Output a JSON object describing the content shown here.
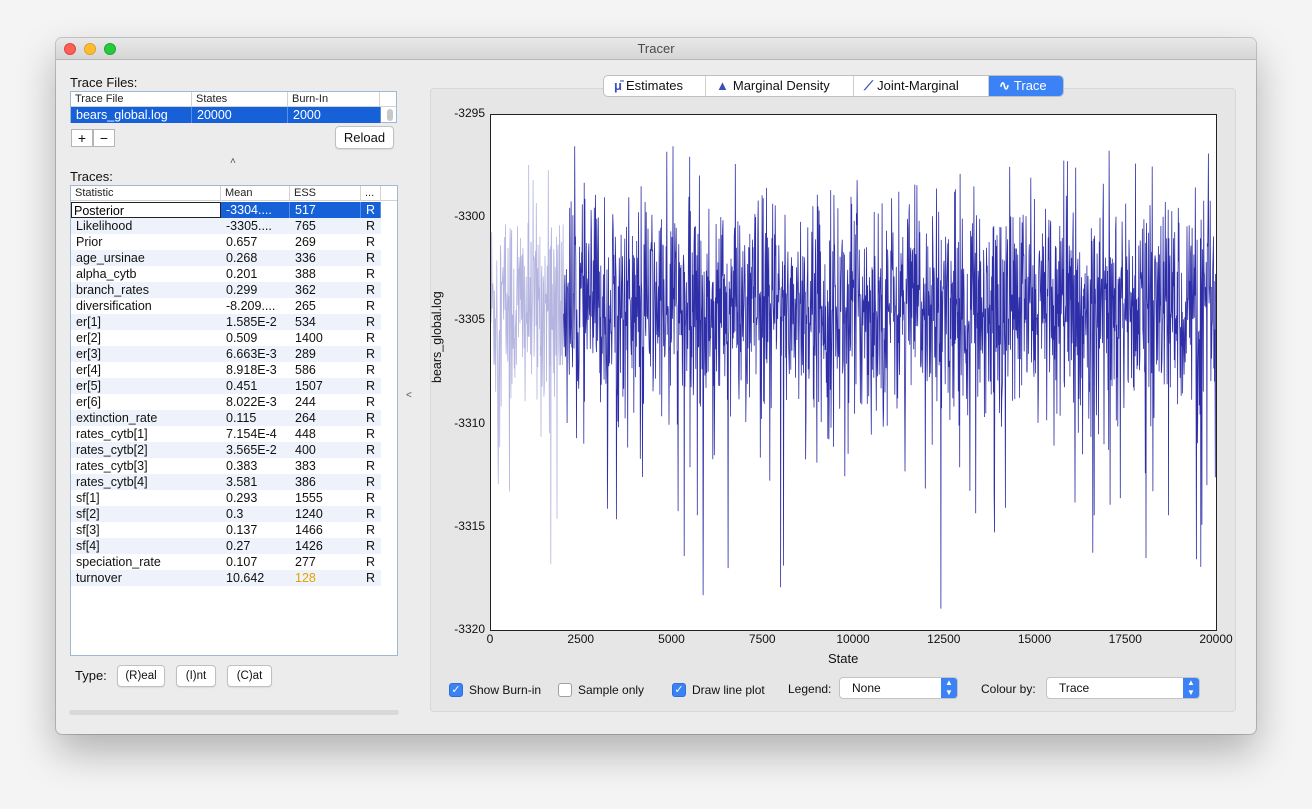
{
  "window": {
    "title": "Tracer"
  },
  "trace_files": {
    "label": "Trace Files:",
    "columns": [
      "Trace File",
      "States",
      "Burn-In"
    ],
    "rows": [
      {
        "file": "bears_global.log",
        "states": "20000",
        "burn_in": "2000"
      }
    ],
    "add_label": "+",
    "remove_label": "−",
    "reload_label": "Reload"
  },
  "traces": {
    "label": "Traces:",
    "columns": [
      "Statistic",
      "Mean",
      "ESS",
      "..."
    ],
    "rows": [
      {
        "stat": "Posterior",
        "mean": "-3304....",
        "ess": "517",
        "type": "R"
      },
      {
        "stat": "Likelihood",
        "mean": "-3305....",
        "ess": "765",
        "type": "R"
      },
      {
        "stat": "Prior",
        "mean": "0.657",
        "ess": "269",
        "type": "R"
      },
      {
        "stat": "age_ursinae",
        "mean": "0.268",
        "ess": "336",
        "type": "R"
      },
      {
        "stat": "alpha_cytb",
        "mean": "0.201",
        "ess": "388",
        "type": "R"
      },
      {
        "stat": "branch_rates",
        "mean": "0.299",
        "ess": "362",
        "type": "R"
      },
      {
        "stat": "diversification",
        "mean": "-8.209....",
        "ess": "265",
        "type": "R"
      },
      {
        "stat": "er[1]",
        "mean": "1.585E-2",
        "ess": "534",
        "type": "R"
      },
      {
        "stat": "er[2]",
        "mean": "0.509",
        "ess": "1400",
        "type": "R"
      },
      {
        "stat": "er[3]",
        "mean": "6.663E-3",
        "ess": "289",
        "type": "R"
      },
      {
        "stat": "er[4]",
        "mean": "8.918E-3",
        "ess": "586",
        "type": "R"
      },
      {
        "stat": "er[5]",
        "mean": "0.451",
        "ess": "1507",
        "type": "R"
      },
      {
        "stat": "er[6]",
        "mean": "8.022E-3",
        "ess": "244",
        "type": "R"
      },
      {
        "stat": "extinction_rate",
        "mean": "0.115",
        "ess": "264",
        "type": "R"
      },
      {
        "stat": "rates_cytb[1]",
        "mean": "7.154E-4",
        "ess": "448",
        "type": "R"
      },
      {
        "stat": "rates_cytb[2]",
        "mean": "3.565E-2",
        "ess": "400",
        "type": "R"
      },
      {
        "stat": "rates_cytb[3]",
        "mean": "0.383",
        "ess": "383",
        "type": "R"
      },
      {
        "stat": "rates_cytb[4]",
        "mean": "3.581",
        "ess": "386",
        "type": "R"
      },
      {
        "stat": "sf[1]",
        "mean": "0.293",
        "ess": "1555",
        "type": "R"
      },
      {
        "stat": "sf[2]",
        "mean": "0.3",
        "ess": "1240",
        "type": "R"
      },
      {
        "stat": "sf[3]",
        "mean": "0.137",
        "ess": "1466",
        "type": "R"
      },
      {
        "stat": "sf[4]",
        "mean": "0.27",
        "ess": "1426",
        "type": "R"
      },
      {
        "stat": "speciation_rate",
        "mean": "0.107",
        "ess": "277",
        "type": "R"
      },
      {
        "stat": "turnover",
        "mean": "10.642",
        "ess": "128",
        "type": "R",
        "ess_color": "#e6a000"
      }
    ]
  },
  "type_controls": {
    "label": "Type:",
    "real": "(R)eal",
    "int": "(I)nt",
    "cat": "(C)at"
  },
  "tabs": [
    {
      "label": "Estimates",
      "icon": "mu-icon"
    },
    {
      "label": "Marginal Density",
      "icon": "density-icon"
    },
    {
      "label": "Joint-Marginal",
      "icon": "joint-icon"
    },
    {
      "label": "Trace",
      "icon": "trace-icon",
      "active": true
    }
  ],
  "chart_data": {
    "type": "line",
    "xlabel": "State",
    "ylabel": "bears_global.log",
    "xlim": [
      0,
      20000
    ],
    "ylim": [
      -3320,
      -3295
    ],
    "xticks": [
      "0",
      "2500",
      "5000",
      "7500",
      "10000",
      "12500",
      "15000",
      "17500",
      "20000"
    ],
    "yticks": [
      "-3295",
      "-3300",
      "-3305",
      "-3310",
      "-3315",
      "-3320"
    ],
    "burn_in": 2000,
    "series": [
      {
        "color": "#2e2ea8",
        "burnin_color": "#b4b4e0"
      }
    ]
  },
  "controls": {
    "show_burnin": "Show Burn-in",
    "sample_only": "Sample only",
    "draw_line_plot": "Draw line plot",
    "legend_label": "Legend:",
    "legend_value": "None",
    "colour_label": "Colour by:",
    "colour_value": "Trace"
  }
}
